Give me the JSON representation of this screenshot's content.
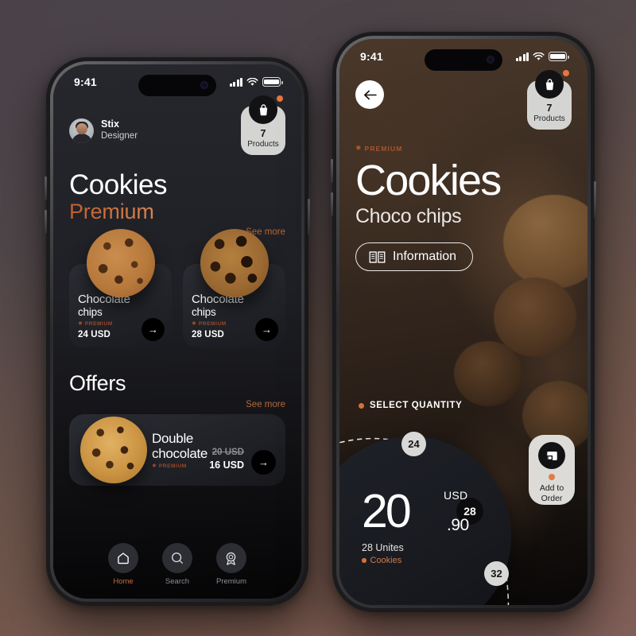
{
  "background": {
    "top_color": "#494047",
    "bottom_color": "#7c5b50"
  },
  "accent": {
    "orange": "#d4703c",
    "copper": "#b4683a",
    "premium": "#9e4a2c"
  },
  "left_phone": {
    "status_bar": {
      "time": "9:41",
      "signal_icon": "signal-bars-icon",
      "wifi_icon": "wifi-icon",
      "battery_icon": "battery-icon"
    },
    "profile": {
      "name": "Stix",
      "role": "Designer",
      "avatar_icon": "avatar"
    },
    "cart": {
      "count": "7",
      "label": "Products",
      "bag_icon": "shopping-bag-icon",
      "badge_icon": "notification-dot"
    },
    "heading": {
      "title": "Cookies",
      "subtitle": "Premium"
    },
    "see_more": "See more",
    "products": [
      {
        "title": "Chocolate",
        "subtitle": "chips",
        "badge": "PREMIUM",
        "price": "24 USD",
        "arrow_icon": "arrow-right-icon",
        "cookie_icon": "cookie-golden"
      },
      {
        "title": "Chocolate",
        "subtitle": "chips",
        "badge": "PREMIUM",
        "price": "28 USD",
        "arrow_icon": "arrow-right-icon",
        "cookie_icon": "cookie-dark"
      }
    ],
    "offers": {
      "heading": "Offers",
      "see_more": "See more",
      "item": {
        "title": "Double",
        "subtitle": "chocolate",
        "badge": "PREMIUM",
        "old_price": "20 USD",
        "new_price": "16 USD",
        "arrow_icon": "arrow-right-icon",
        "cookie_icon": "cookie-chip"
      }
    },
    "tabs": [
      {
        "label": "Home",
        "icon": "home-icon",
        "active": true
      },
      {
        "label": "Search",
        "icon": "search-icon",
        "active": false
      },
      {
        "label": "Premium",
        "icon": "medal-icon",
        "active": false
      }
    ]
  },
  "right_phone": {
    "status_bar": {
      "time": "9:41",
      "signal_icon": "signal-bars-icon",
      "wifi_icon": "wifi-icon",
      "battery_icon": "battery-icon"
    },
    "back_icon": "arrow-left-icon",
    "cart": {
      "count": "7",
      "label": "Products",
      "bag_icon": "shopping-bag-icon",
      "badge_icon": "notification-dot"
    },
    "premium_badge": "PREMIUM",
    "title": "Cookies",
    "subtitle": "Choco chips",
    "information_button": {
      "label": "Information",
      "icon": "book-icon"
    },
    "quantity": {
      "section_label": "SELECT QUANTITY",
      "options": [
        {
          "value": "24",
          "selected": false
        },
        {
          "value": "28",
          "selected": true
        },
        {
          "value": "32",
          "selected": false
        }
      ]
    },
    "price": {
      "whole": "20",
      "cents": ".90",
      "currency": "USD",
      "units": "28 Unites",
      "category": "Cookies"
    },
    "add_to_order": {
      "line1": "Add to",
      "line2": "Order",
      "icon": "box-icon",
      "dot_icon": "status-dot"
    }
  }
}
